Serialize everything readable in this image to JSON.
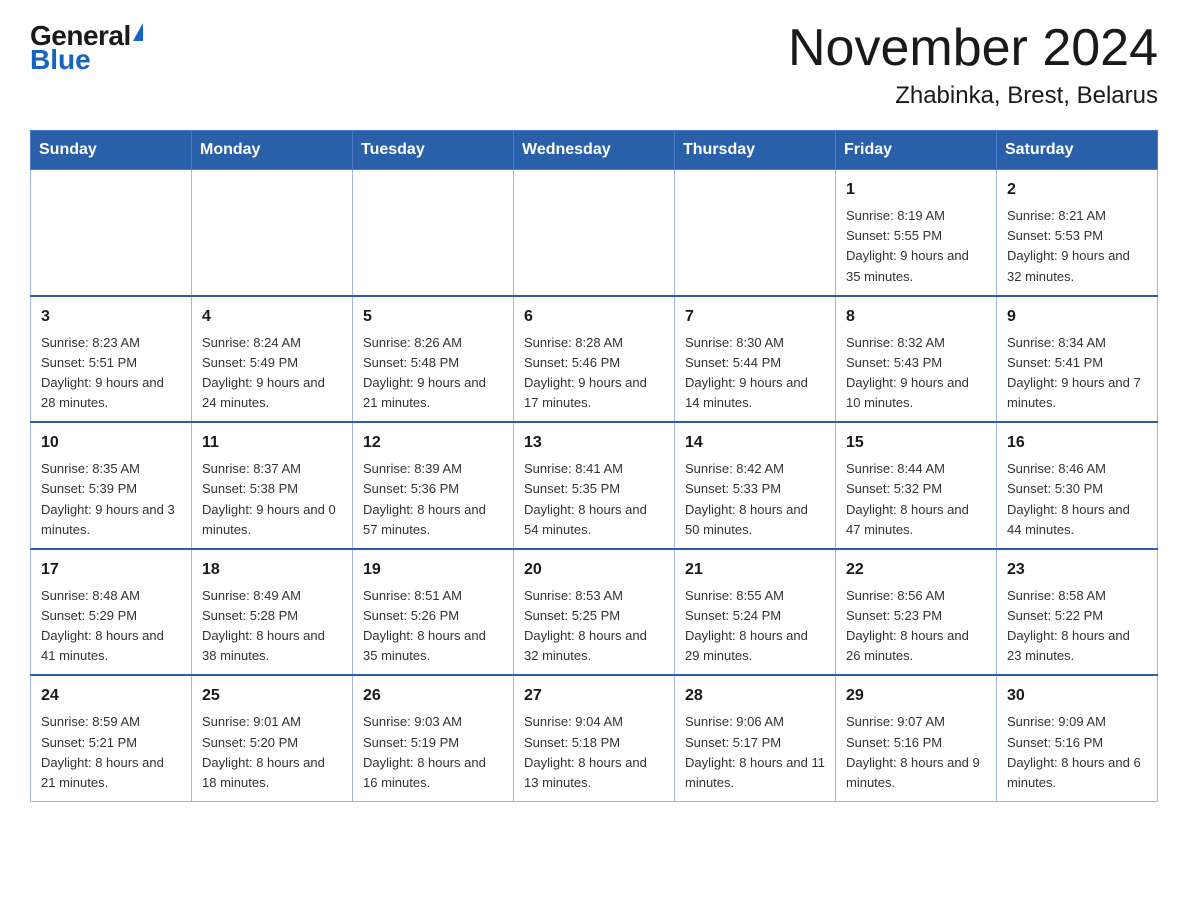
{
  "logo": {
    "general": "General",
    "blue": "Blue"
  },
  "title": "November 2024",
  "subtitle": "Zhabinka, Brest, Belarus",
  "weekdays": [
    "Sunday",
    "Monday",
    "Tuesday",
    "Wednesday",
    "Thursday",
    "Friday",
    "Saturday"
  ],
  "weeks": [
    [
      {
        "day": "",
        "info": ""
      },
      {
        "day": "",
        "info": ""
      },
      {
        "day": "",
        "info": ""
      },
      {
        "day": "",
        "info": ""
      },
      {
        "day": "",
        "info": ""
      },
      {
        "day": "1",
        "info": "Sunrise: 8:19 AM\nSunset: 5:55 PM\nDaylight: 9 hours and 35 minutes."
      },
      {
        "day": "2",
        "info": "Sunrise: 8:21 AM\nSunset: 5:53 PM\nDaylight: 9 hours and 32 minutes."
      }
    ],
    [
      {
        "day": "3",
        "info": "Sunrise: 8:23 AM\nSunset: 5:51 PM\nDaylight: 9 hours and 28 minutes."
      },
      {
        "day": "4",
        "info": "Sunrise: 8:24 AM\nSunset: 5:49 PM\nDaylight: 9 hours and 24 minutes."
      },
      {
        "day": "5",
        "info": "Sunrise: 8:26 AM\nSunset: 5:48 PM\nDaylight: 9 hours and 21 minutes."
      },
      {
        "day": "6",
        "info": "Sunrise: 8:28 AM\nSunset: 5:46 PM\nDaylight: 9 hours and 17 minutes."
      },
      {
        "day": "7",
        "info": "Sunrise: 8:30 AM\nSunset: 5:44 PM\nDaylight: 9 hours and 14 minutes."
      },
      {
        "day": "8",
        "info": "Sunrise: 8:32 AM\nSunset: 5:43 PM\nDaylight: 9 hours and 10 minutes."
      },
      {
        "day": "9",
        "info": "Sunrise: 8:34 AM\nSunset: 5:41 PM\nDaylight: 9 hours and 7 minutes."
      }
    ],
    [
      {
        "day": "10",
        "info": "Sunrise: 8:35 AM\nSunset: 5:39 PM\nDaylight: 9 hours and 3 minutes."
      },
      {
        "day": "11",
        "info": "Sunrise: 8:37 AM\nSunset: 5:38 PM\nDaylight: 9 hours and 0 minutes."
      },
      {
        "day": "12",
        "info": "Sunrise: 8:39 AM\nSunset: 5:36 PM\nDaylight: 8 hours and 57 minutes."
      },
      {
        "day": "13",
        "info": "Sunrise: 8:41 AM\nSunset: 5:35 PM\nDaylight: 8 hours and 54 minutes."
      },
      {
        "day": "14",
        "info": "Sunrise: 8:42 AM\nSunset: 5:33 PM\nDaylight: 8 hours and 50 minutes."
      },
      {
        "day": "15",
        "info": "Sunrise: 8:44 AM\nSunset: 5:32 PM\nDaylight: 8 hours and 47 minutes."
      },
      {
        "day": "16",
        "info": "Sunrise: 8:46 AM\nSunset: 5:30 PM\nDaylight: 8 hours and 44 minutes."
      }
    ],
    [
      {
        "day": "17",
        "info": "Sunrise: 8:48 AM\nSunset: 5:29 PM\nDaylight: 8 hours and 41 minutes."
      },
      {
        "day": "18",
        "info": "Sunrise: 8:49 AM\nSunset: 5:28 PM\nDaylight: 8 hours and 38 minutes."
      },
      {
        "day": "19",
        "info": "Sunrise: 8:51 AM\nSunset: 5:26 PM\nDaylight: 8 hours and 35 minutes."
      },
      {
        "day": "20",
        "info": "Sunrise: 8:53 AM\nSunset: 5:25 PM\nDaylight: 8 hours and 32 minutes."
      },
      {
        "day": "21",
        "info": "Sunrise: 8:55 AM\nSunset: 5:24 PM\nDaylight: 8 hours and 29 minutes."
      },
      {
        "day": "22",
        "info": "Sunrise: 8:56 AM\nSunset: 5:23 PM\nDaylight: 8 hours and 26 minutes."
      },
      {
        "day": "23",
        "info": "Sunrise: 8:58 AM\nSunset: 5:22 PM\nDaylight: 8 hours and 23 minutes."
      }
    ],
    [
      {
        "day": "24",
        "info": "Sunrise: 8:59 AM\nSunset: 5:21 PM\nDaylight: 8 hours and 21 minutes."
      },
      {
        "day": "25",
        "info": "Sunrise: 9:01 AM\nSunset: 5:20 PM\nDaylight: 8 hours and 18 minutes."
      },
      {
        "day": "26",
        "info": "Sunrise: 9:03 AM\nSunset: 5:19 PM\nDaylight: 8 hours and 16 minutes."
      },
      {
        "day": "27",
        "info": "Sunrise: 9:04 AM\nSunset: 5:18 PM\nDaylight: 8 hours and 13 minutes."
      },
      {
        "day": "28",
        "info": "Sunrise: 9:06 AM\nSunset: 5:17 PM\nDaylight: 8 hours and 11 minutes."
      },
      {
        "day": "29",
        "info": "Sunrise: 9:07 AM\nSunset: 5:16 PM\nDaylight: 8 hours and 9 minutes."
      },
      {
        "day": "30",
        "info": "Sunrise: 9:09 AM\nSunset: 5:16 PM\nDaylight: 8 hours and 6 minutes."
      }
    ]
  ]
}
